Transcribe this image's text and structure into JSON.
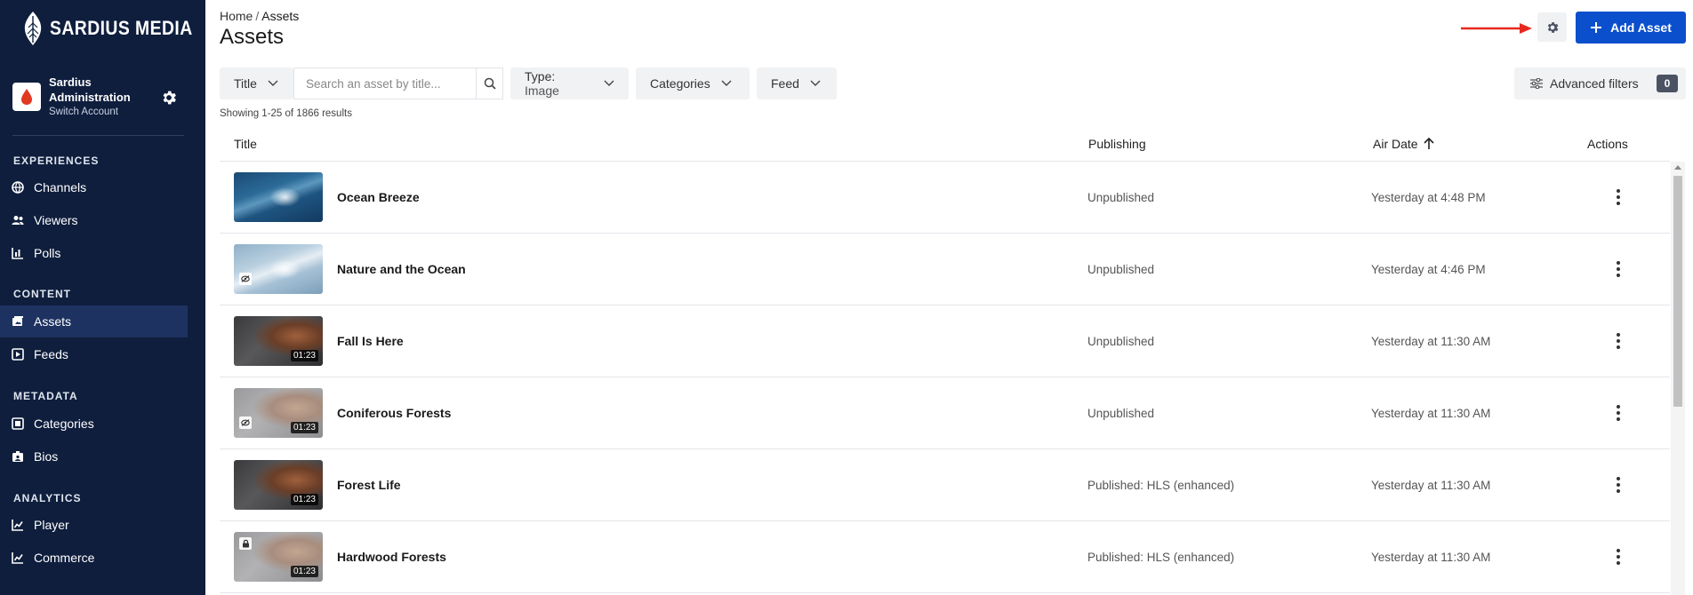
{
  "app": {
    "brand": "SARDIUS MEDIA"
  },
  "account": {
    "name": "Sardius Administration",
    "switch_label": "Switch Account"
  },
  "sidebar": {
    "sections": [
      {
        "label": "EXPERIENCES",
        "items": [
          "Channels",
          "Viewers",
          "Polls"
        ]
      },
      {
        "label": "CONTENT",
        "items": [
          "Assets",
          "Feeds"
        ]
      },
      {
        "label": "METADATA",
        "items": [
          "Categories",
          "Bios"
        ]
      },
      {
        "label": "ANALYTICS",
        "items": [
          "Player",
          "Commerce"
        ]
      }
    ],
    "active_item": "Assets"
  },
  "header": {
    "breadcrumb": {
      "home": "Home",
      "separator": "/",
      "current": "Assets"
    },
    "title": "Assets",
    "add_button": "Add Asset"
  },
  "filters": {
    "title_dropdown": "Title",
    "search_placeholder": "Search an asset by title...",
    "type_key": "Type:",
    "type_value": "Image",
    "categories": "Categories",
    "feed": "Feed",
    "advanced": "Advanced filters",
    "advanced_count": "0"
  },
  "results": {
    "summary": "Showing 1-25 of 1866 results"
  },
  "table": {
    "columns": {
      "title": "Title",
      "publishing": "Publishing",
      "air_date": "Air Date",
      "actions": "Actions"
    },
    "rows": [
      {
        "title": "Ocean Breeze",
        "publishing": "Unpublished",
        "air_date": "Yesterday at 4:48 PM",
        "duration": ""
      },
      {
        "title": "Nature and the Ocean",
        "publishing": "Unpublished",
        "air_date": "Yesterday at 4:46 PM",
        "duration": ""
      },
      {
        "title": "Fall Is Here",
        "publishing": "Unpublished",
        "air_date": "Yesterday at 11:30 AM",
        "duration": "01:23"
      },
      {
        "title": "Coniferous Forests",
        "publishing": "Unpublished",
        "air_date": "Yesterday at 11:30 AM",
        "duration": "01:23"
      },
      {
        "title": "Forest Life",
        "publishing": "Published: HLS (enhanced)",
        "air_date": "Yesterday at 11:30 AM",
        "duration": "01:23"
      },
      {
        "title": "Hardwood Forests",
        "publishing": "Published: HLS (enhanced)",
        "air_date": "Yesterday at 11:30 AM",
        "duration": "01:23"
      }
    ]
  },
  "colors": {
    "sidebar_bg": "#0f1e3d",
    "sidebar_active": "#1d3260",
    "primary": "#0b4fcc",
    "annotation": "#e8281e"
  }
}
